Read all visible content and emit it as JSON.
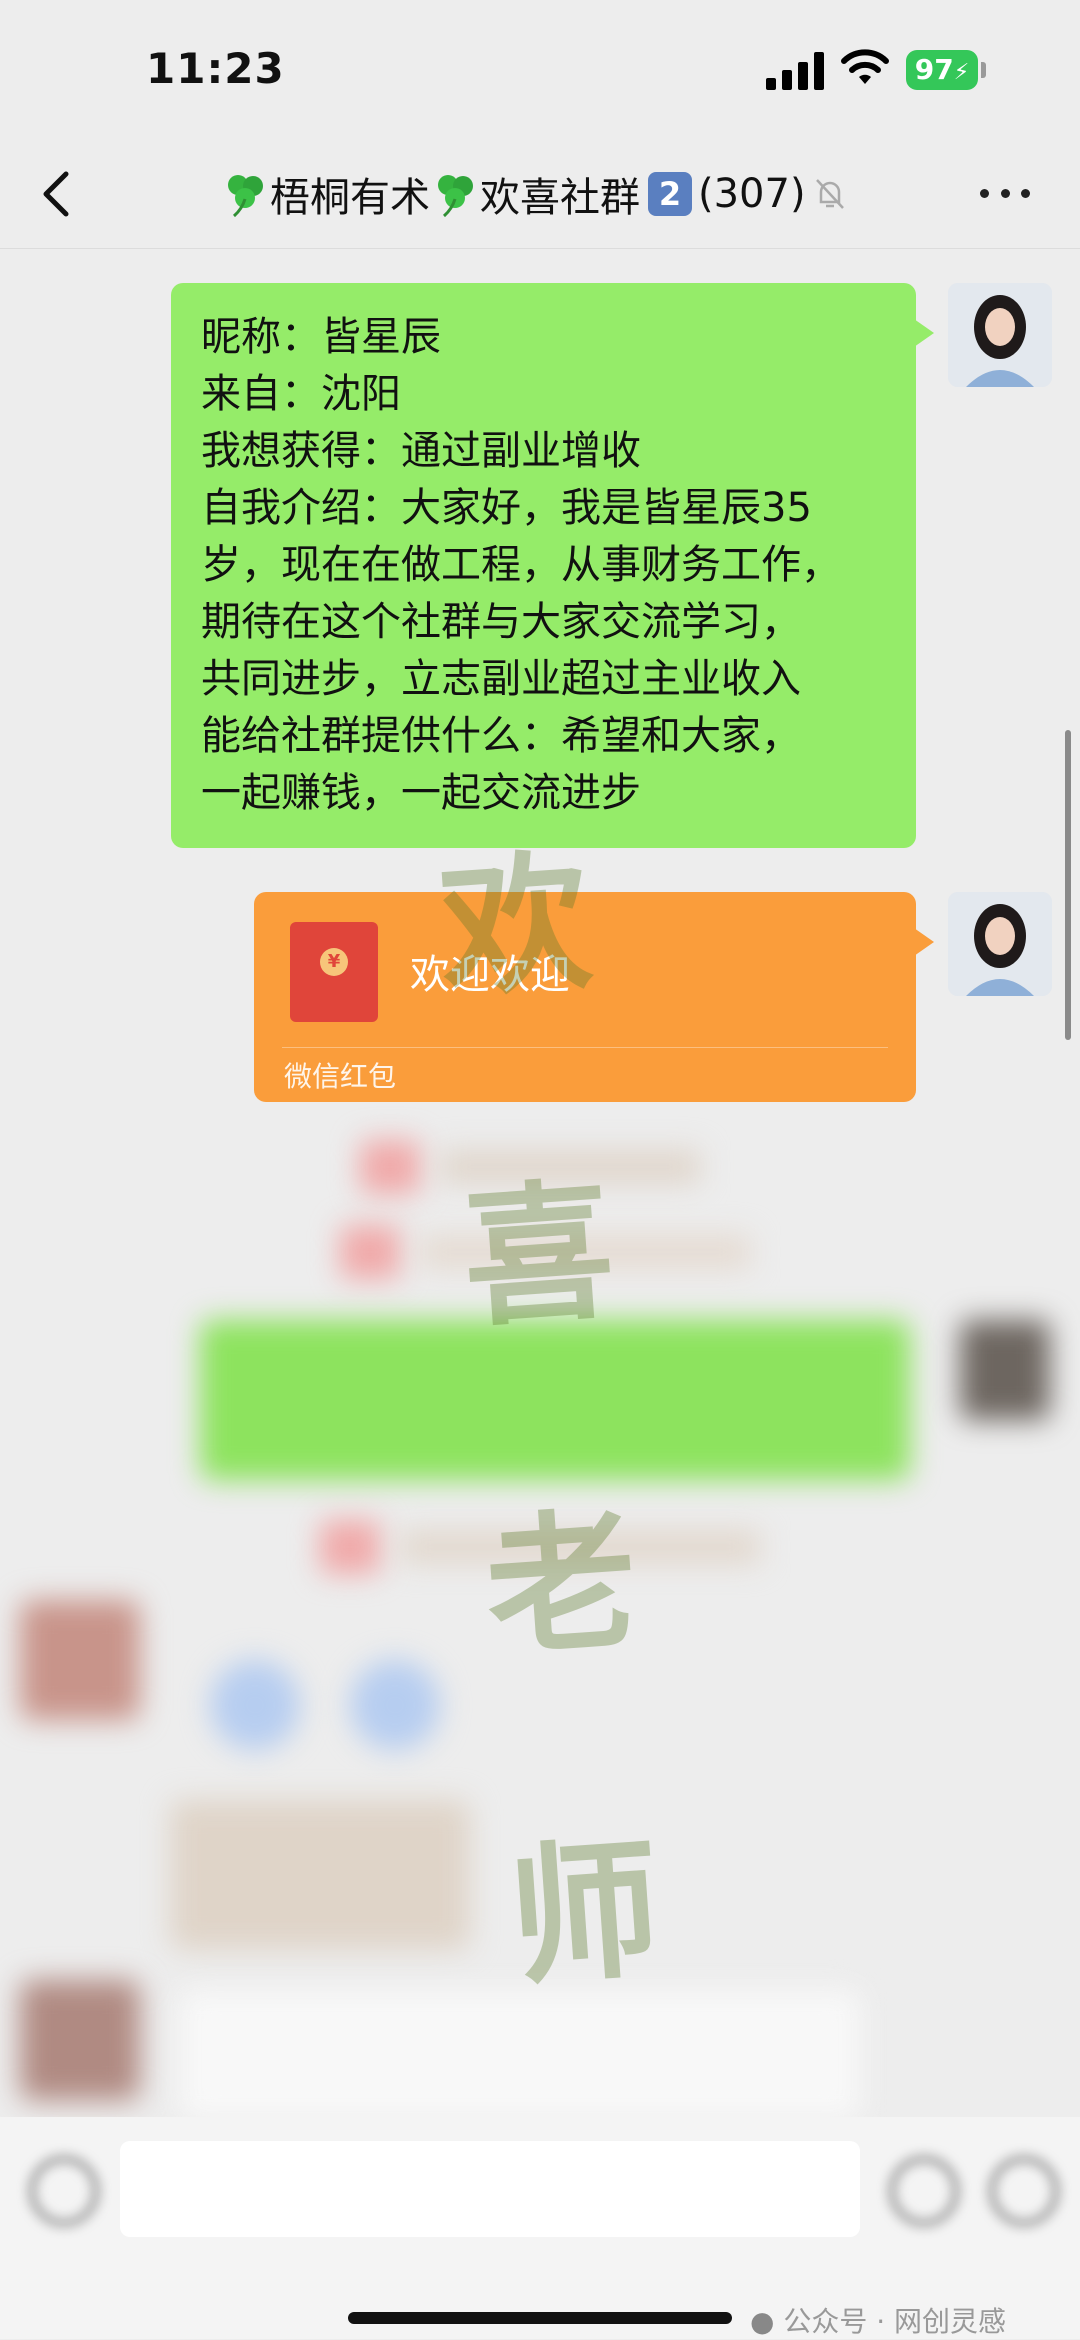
{
  "status_bar": {
    "time": "11:23",
    "battery": "97"
  },
  "nav": {
    "title": "梧桐有术",
    "title_suffix": "欢喜社群",
    "badge": "2",
    "member_count": "(307)"
  },
  "messages": {
    "intro": {
      "lines": [
        "昵称：皆星辰",
        "来自：沈阳",
        "我想获得：通过副业增收",
        "自我介绍：大家好，我是皆星辰35",
        "岁，现在在做工程，从事财务工作，",
        "期待在这个社群与大家交流学习，",
        "共同进步，立志副业超过主业收入",
        "能给社群提供什么：希望和大家，",
        "一起赚钱，一起交流进步"
      ]
    },
    "red_packet": {
      "title": "欢迎欢迎",
      "footer": "微信红包"
    }
  },
  "watermark": [
    "欢",
    "喜",
    "老",
    "师"
  ],
  "footer_credit": "公众号 · 网创灵感"
}
